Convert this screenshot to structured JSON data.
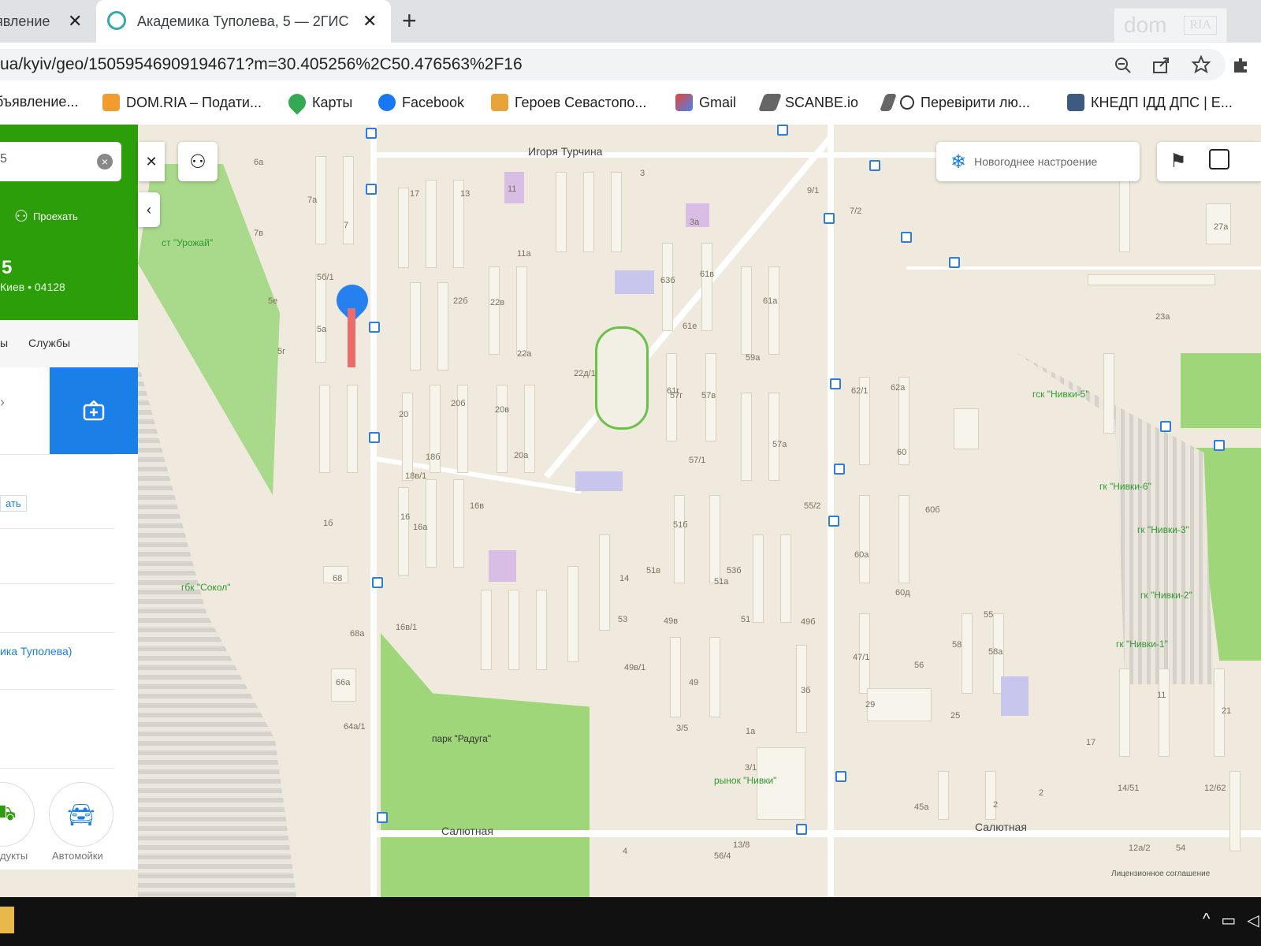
{
  "browser": {
    "tabs": [
      {
        "title": "явление",
        "close": "✕"
      },
      {
        "title": "Академика Туполева, 5 — 2ГИС",
        "close": "✕",
        "active": true
      }
    ],
    "new_tab": "+",
    "url": "ua/kyiv/geo/15059546909194671?m=30.405256%2C50.476563%2F16",
    "bookmarks": [
      {
        "label": "бъявление...",
        "icon": "page-icon"
      },
      {
        "label": "DOM.RIA – Подати...",
        "icon": "domria-icon"
      },
      {
        "label": "Карты",
        "icon": "maps-pin-icon"
      },
      {
        "label": "Facebook",
        "icon": "facebook-icon"
      },
      {
        "label": "Героев Севастопо...",
        "icon": "site-icon"
      },
      {
        "label": "Gmail",
        "icon": "gmail-icon"
      },
      {
        "label": "SCANBE.io",
        "icon": "scanbe-icon"
      },
      {
        "label": "Перевірити лю...",
        "icon": "search-key-icon"
      },
      {
        "label": "КНЕДП ІДД ДПС | Е...",
        "icon": "kedp-icon"
      }
    ],
    "watermark": {
      "text": "dom",
      "badge": "RIA"
    }
  },
  "panel": {
    "search_value": "5",
    "route_label": "Проехать",
    "building_number": "5",
    "address_line": "Киев • 04128",
    "tabs": [
      "ы",
      "Службы"
    ],
    "action_link": "ать",
    "street_link": "ика Туполева)",
    "categories": [
      "дукты",
      "Автомойки"
    ]
  },
  "map": {
    "streets": [
      "Игоря Турчина",
      "Салютная",
      "Салютная"
    ],
    "green_labels": [
      "ст \"Урожай\"",
      "гбк \"Сокол\"",
      "парк \"Радуга\"",
      "рынок \"Нивки\"",
      "гск \"Нивки-5\"",
      "гк \"Нивки-6\"",
      "гк \"Нивки-3\"",
      "гк \"Нивки-2\"",
      "гк \"Нивки-1\""
    ],
    "house_numbers": [
      "6а",
      "7а",
      "7в",
      "7",
      "17",
      "13",
      "11",
      "3",
      "9/1",
      "3а",
      "7/2",
      "5б/1",
      "5е",
      "5а",
      "5г",
      "11а",
      "22б",
      "22в",
      "22а",
      "22д/1",
      "20б",
      "20в",
      "20",
      "20а",
      "18б",
      "18в/1",
      "16",
      "16в/1",
      "16а",
      "16в",
      "14",
      "63б",
      "61в",
      "61е",
      "61а",
      "61г",
      "59а",
      "57г",
      "57в",
      "57а",
      "57/1",
      "55/2",
      "53б",
      "51б",
      "51в",
      "51а",
      "51",
      "53",
      "49в",
      "49б",
      "49в/1",
      "49",
      "3/1",
      "1а",
      "3/5",
      "3б",
      "1б",
      "68",
      "68а",
      "66а",
      "64а/1",
      "62/1",
      "62а",
      "60",
      "60б",
      "60а",
      "60д",
      "47/1",
      "56",
      "58",
      "58а",
      "55",
      "23а",
      "27а",
      "29",
      "25",
      "21",
      "17",
      "11",
      "12/62",
      "14/51",
      "2",
      "2",
      "45а",
      "12а/2",
      "54",
      "4",
      "56/4",
      "13/8"
    ],
    "mood_label": "Новогоднее настроение",
    "license": "Лицензионное соглашение"
  },
  "colors": {
    "green_panel": "#2b9e0a",
    "blue_button": "#1a7fe6",
    "map_bg": "#efeadd",
    "park": "#9fd67a",
    "marker": "#2680f0"
  }
}
